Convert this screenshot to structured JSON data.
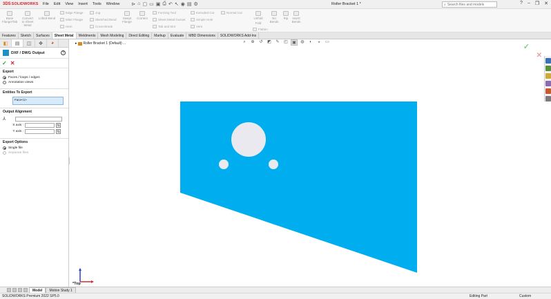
{
  "app": {
    "brand_prefix": "3DS",
    "brand_name": "SOLIDWORKS",
    "document_title": "Roller Bracket 1 *",
    "menus": [
      "File",
      "Edit",
      "View",
      "Insert",
      "Tools",
      "Window"
    ],
    "search_placeholder": "Search files and models"
  },
  "toolbar": {
    "big_tools": [
      {
        "label": "Base\nFlange/Tab"
      },
      {
        "label": "Convert\nto Sheet\nMetal"
      },
      {
        "label": "Lofted-Bend"
      },
      {
        "label": "Swept\nFlange"
      },
      {
        "label": "Corners"
      },
      {
        "label": "Unfold"
      },
      {
        "label": "Fold"
      },
      {
        "label": "No\nBends"
      },
      {
        "label": "Rip"
      },
      {
        "label": "Insert\nBends"
      }
    ],
    "small_tools": [
      "Edge Flange",
      "Miter Flange",
      "Hem",
      "Jog",
      "Sketched Bend",
      "Cross-Break",
      "Forming Tool",
      "Sheet Metal Gusset",
      "Tab and Slot",
      "Extruded Cut",
      "Simple Hole",
      "Vent",
      "Normal Cut",
      "Flatten"
    ]
  },
  "tabs": [
    "Features",
    "Sketch",
    "Surfaces",
    "Sheet Metal",
    "Weldments",
    "Mesh Modeling",
    "Direct Editing",
    "Markup",
    "Evaluate",
    "MBD Dimensions",
    "SOLIDWORKS Add-Ins"
  ],
  "active_tab": "Sheet Metal",
  "property_manager": {
    "title": "DXF / DWG Output",
    "help": "?",
    "ok": "✓",
    "cancel": "✕",
    "export": {
      "title": "Export",
      "options": [
        "Faces / loops / edges",
        "Annotation views"
      ],
      "selected": "Faces / loops / edges"
    },
    "entities": {
      "title": "Entities To Export",
      "value": "Face<1>"
    },
    "alignment": {
      "title": "Output Alignment",
      "x_label": "X axis :",
      "y_label": "Y axis :"
    },
    "export_options": {
      "title": "Export Options",
      "options": [
        "Single file",
        "Separate files"
      ],
      "selected": "Single file"
    }
  },
  "viewport": {
    "feature_node": "Roller Bracket 1 (Default) ...",
    "view_orientation": "*Top",
    "part_color": "#00aeef"
  },
  "bottom_tabs": [
    "Model",
    "Motion Study 1"
  ],
  "active_bottom_tab": "Model",
  "status": {
    "product": "SOLIDWORKS Premium 2022 SP5.0",
    "mode": "Editing Part",
    "units": "Custom"
  }
}
